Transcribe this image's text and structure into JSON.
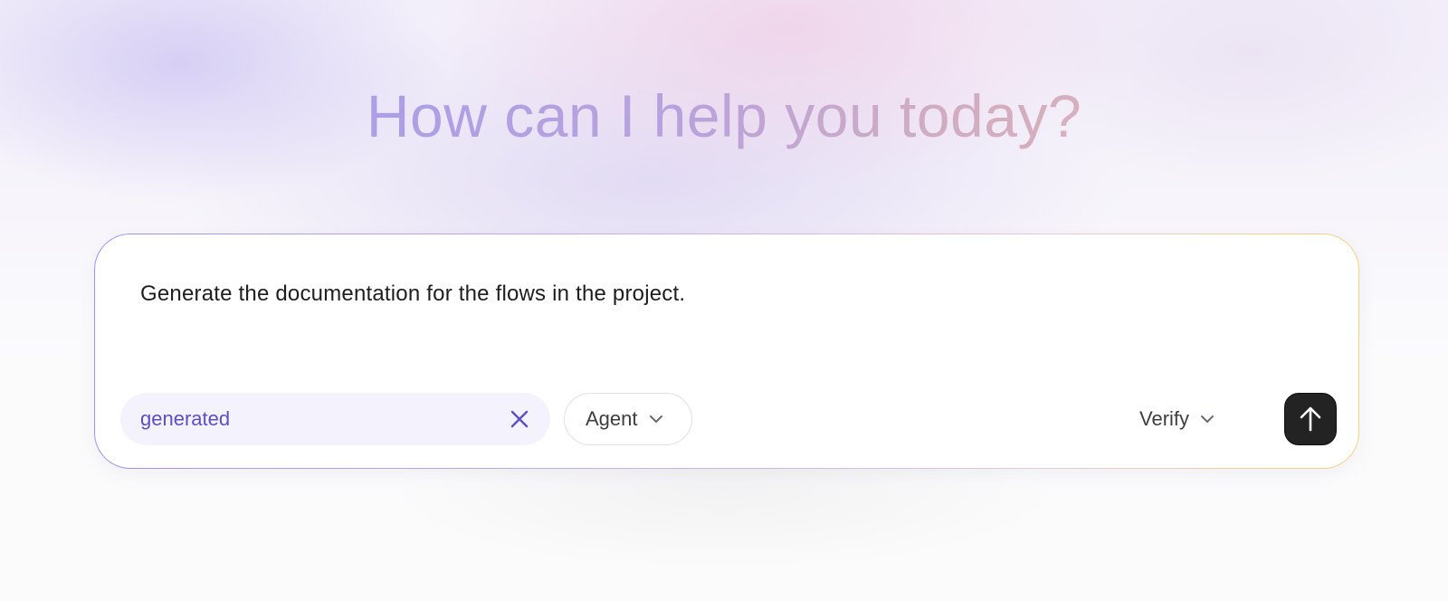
{
  "header": {
    "title": "How can I help you today?"
  },
  "composer": {
    "prompt_text": "Generate the documentation for the flows in the project.",
    "context_chip": {
      "label": "generated",
      "clear_icon": "close-icon"
    },
    "mode_dropdown": {
      "selected": "Agent",
      "icon": "chevron-down-icon"
    },
    "verify_dropdown": {
      "selected": "Verify",
      "icon": "chevron-down-icon"
    },
    "send_button": {
      "icon": "arrow-up-icon"
    }
  },
  "colors": {
    "chip_text": "#5a4fc8",
    "send_button_bg": "#232323",
    "border_start": "#9e92f0",
    "border_end": "#f4d27a"
  }
}
